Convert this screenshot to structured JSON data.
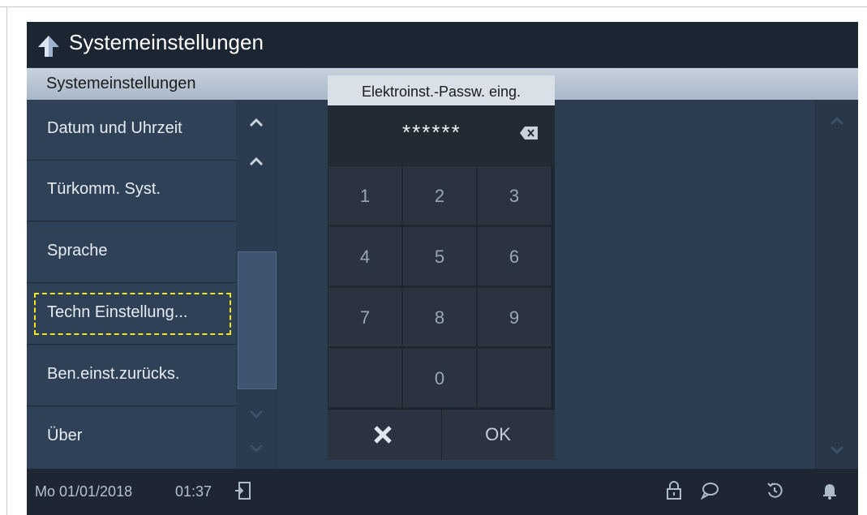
{
  "header": {
    "title": "Systemeinstellungen"
  },
  "subheader": {
    "label": "Systemeinstellungen"
  },
  "menu": {
    "items": [
      {
        "label": "Datum und Uhrzeit"
      },
      {
        "label": "Türkomm. Syst."
      },
      {
        "label": "Sprache"
      },
      {
        "label": "Techn Einstellung..."
      },
      {
        "label": "Ben.einst.zurücks."
      },
      {
        "label": "Über"
      }
    ],
    "focused_index": 3
  },
  "dialog": {
    "title": "Elektroinst.-Passw. eing.",
    "password_mask": "******",
    "keys": [
      "1",
      "2",
      "3",
      "4",
      "5",
      "6",
      "7",
      "8",
      "9",
      "0"
    ],
    "ok_label": "OK"
  },
  "statusbar": {
    "date": "Mo 01/01/2018",
    "time": "01:37"
  },
  "icons": {
    "back": "back-arrow-icon",
    "backspace": "backspace-icon",
    "cancel": "close-icon",
    "logout": "door-exit-icon",
    "lock": "lock-icon",
    "message": "chat-bubble-icon",
    "history": "history-icon",
    "bell": "bell-icon"
  },
  "colors": {
    "focus": "#f4e41a",
    "background": "#2c3d52"
  }
}
